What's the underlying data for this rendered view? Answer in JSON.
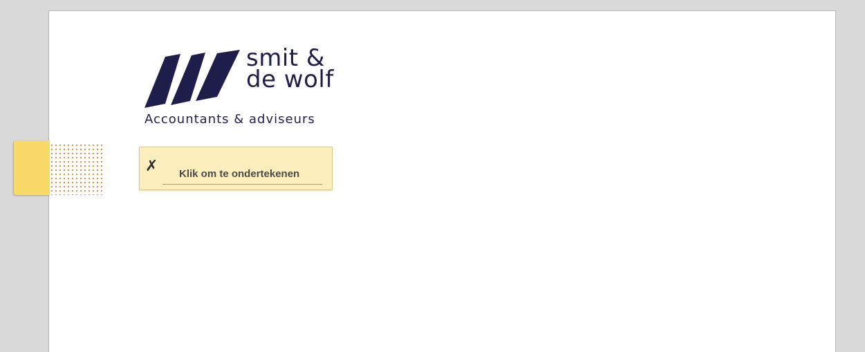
{
  "logo": {
    "name_line1": "smit &",
    "name_line2": "de wolf",
    "tagline": "Accountants & adviseurs",
    "color": "#1f1e4a"
  },
  "signature_field": {
    "x_mark": "✗",
    "label": "Klik om te ondertekenen",
    "background": "#fcefbd"
  },
  "side_tab": {
    "color": "#f9d968",
    "dot_color": "#e38a2c"
  }
}
